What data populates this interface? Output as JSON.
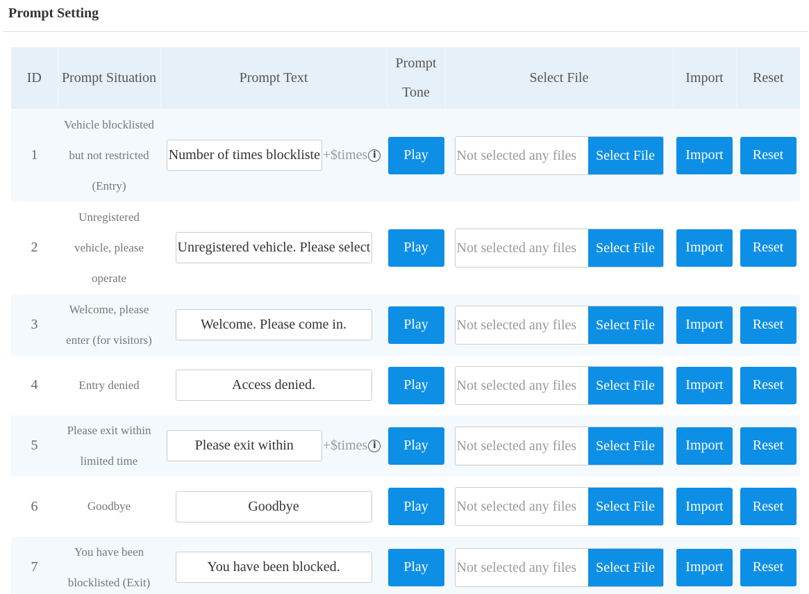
{
  "page_title": "Prompt Setting",
  "columns": {
    "id": "ID",
    "situation": "Prompt Situation",
    "text": "Prompt Text",
    "tone": "Prompt Tone",
    "file": "Select File",
    "import": "Import",
    "reset": "Reset"
  },
  "labels": {
    "play": "Play",
    "file_placeholder": "Not selected any files",
    "select_file": "Select File",
    "import": "Import",
    "reset": "Reset",
    "suffix": "+$times",
    "info_icon_glyph": "i"
  },
  "rows": [
    {
      "id": "1",
      "situation": "Vehicle blocklisted but not restricted (Entry)",
      "text": "Number of times blocklisted",
      "has_suffix": true
    },
    {
      "id": "2",
      "situation": "Unregistered vehicle, please operate",
      "text": "Unregistered vehicle. Please select",
      "has_suffix": false
    },
    {
      "id": "3",
      "situation": "Welcome, please enter (for visitors)",
      "text": "Welcome. Please come in.",
      "has_suffix": false
    },
    {
      "id": "4",
      "situation": "Entry denied",
      "text": "Access denied.",
      "has_suffix": false
    },
    {
      "id": "5",
      "situation": "Please exit within limited time",
      "text": "Please exit within",
      "has_suffix": true
    },
    {
      "id": "6",
      "situation": "Goodbye",
      "text": "Goodbye",
      "has_suffix": false
    },
    {
      "id": "7",
      "situation": "You have been blocklisted (Exit)",
      "text": "You have been blocked.",
      "has_suffix": false
    }
  ],
  "colors": {
    "accent": "#0e8fe6",
    "header_bg": "#e6f0f8",
    "row_alt_bg": "#f4f9fd"
  }
}
